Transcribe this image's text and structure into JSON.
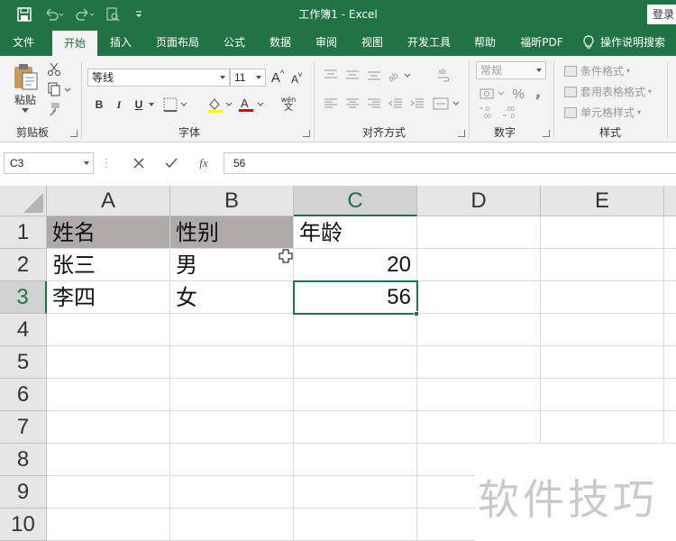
{
  "titlebar": {
    "title": "工作簿1  -  Excel",
    "login_label": "登录"
  },
  "tabs": [
    {
      "label": "文件"
    },
    {
      "label": "开始"
    },
    {
      "label": "插入"
    },
    {
      "label": "页面布局"
    },
    {
      "label": "公式"
    },
    {
      "label": "数据"
    },
    {
      "label": "审阅"
    },
    {
      "label": "视图"
    },
    {
      "label": "开发工具"
    },
    {
      "label": "帮助"
    },
    {
      "label": "福昕PDF"
    },
    {
      "label": "操作说明搜索"
    }
  ],
  "ribbon": {
    "clipboard": {
      "paste_label": "粘贴",
      "group_label": "剪贴板"
    },
    "font": {
      "font_name": "等线",
      "font_size": "11",
      "group_label": "字体",
      "bold": "B",
      "italic": "I",
      "underline": "U",
      "grow": "A",
      "shrink": "A",
      "phonetic": "wén"
    },
    "alignment": {
      "group_label": "对齐方式"
    },
    "number": {
      "format": "常规",
      "percent": "%",
      "comma": ",",
      "group_label": "数字"
    },
    "styles": {
      "conditional": "条件格式",
      "table": "套用表格格式",
      "cell": "单元格样式",
      "group_label": "样式"
    }
  },
  "formula_bar": {
    "name_box": "C3",
    "value": "56",
    "fx": "fx"
  },
  "columns": [
    "A",
    "B",
    "C",
    "D",
    "E"
  ],
  "rows": [
    "1",
    "2",
    "3",
    "4",
    "5",
    "6",
    "7",
    "8",
    "9",
    "10"
  ],
  "cells": {
    "A1": "姓名",
    "B1": "性别",
    "C1": "年龄",
    "A2": "张三",
    "B2": "男",
    "C2": "20",
    "A3": "李四",
    "B3": "女",
    "C3": "56"
  },
  "watermark": "软件技巧",
  "colors": {
    "accent": "#217346",
    "header_fill": "#aeaaaa"
  }
}
